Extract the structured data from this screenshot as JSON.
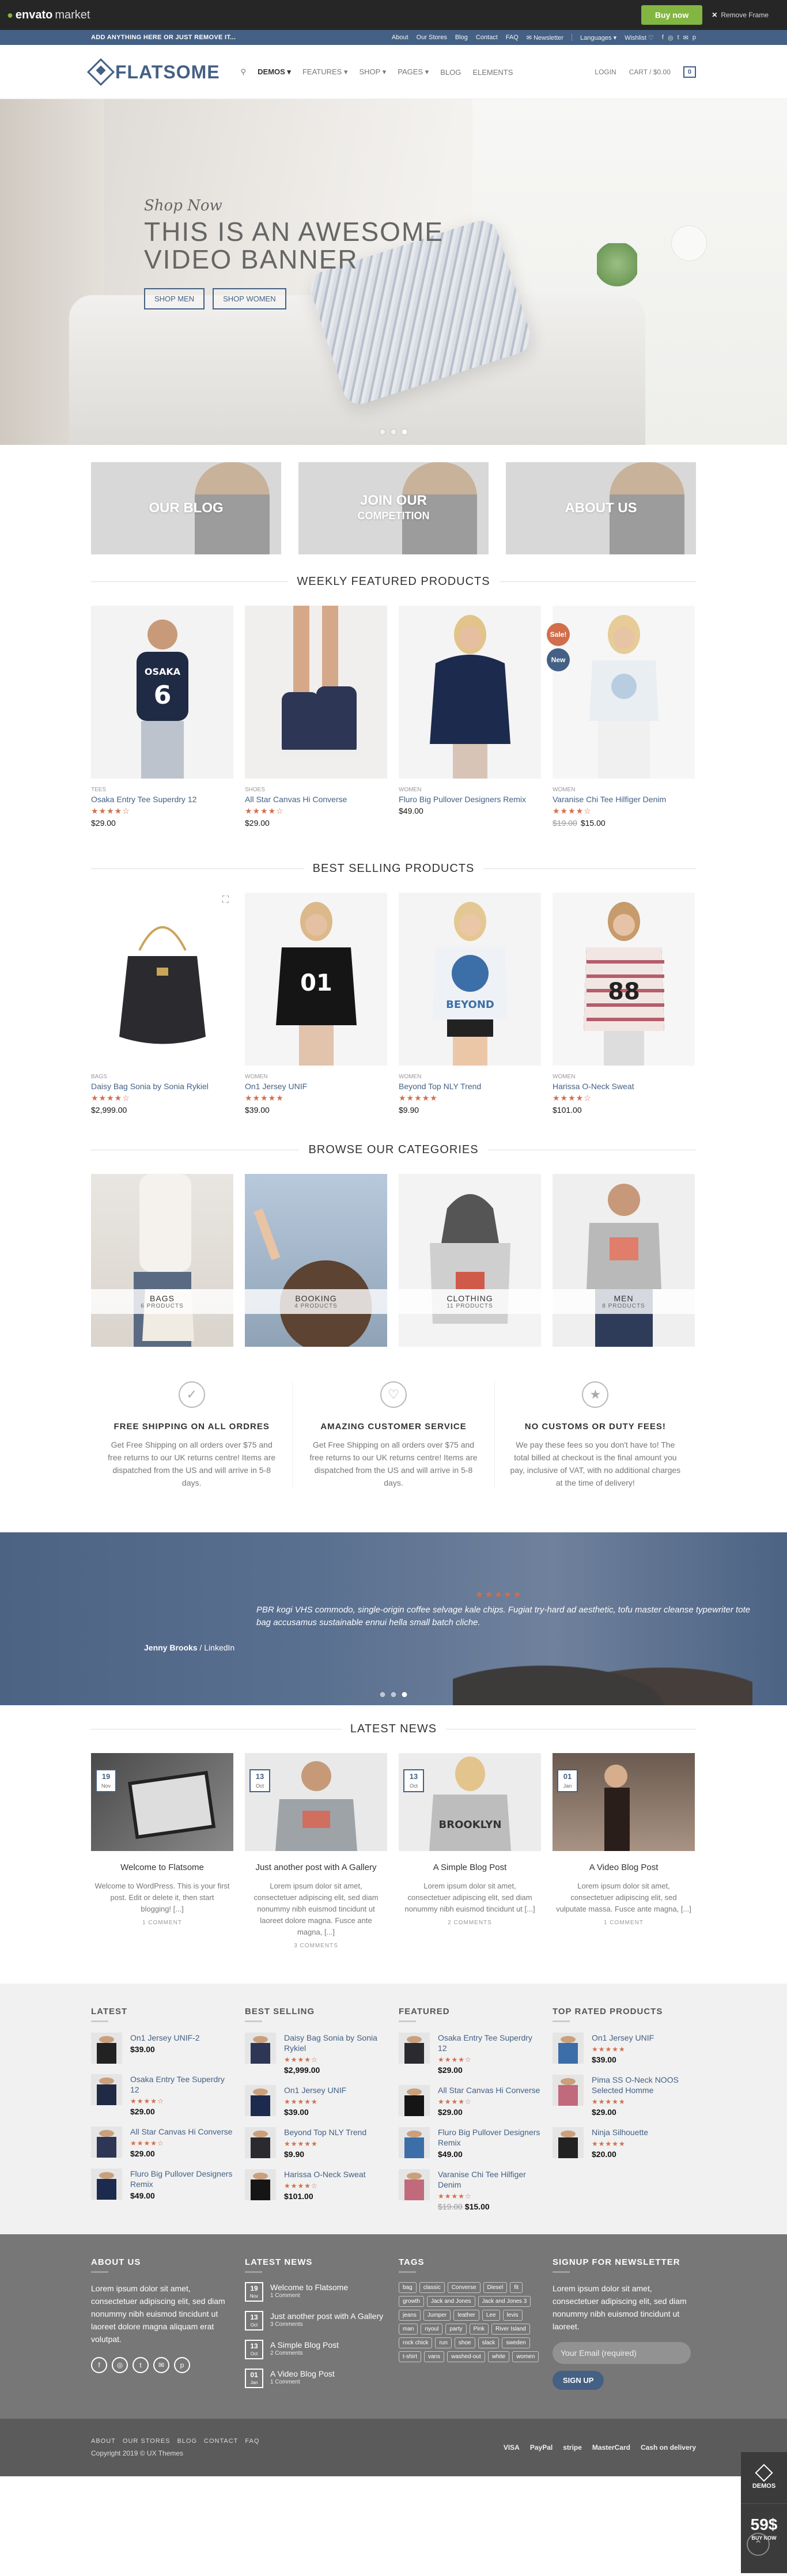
{
  "envato": {
    "brand_bold": "envato",
    "brand_light": "market",
    "buy_label": "Buy now",
    "remove_label": "Remove Frame"
  },
  "topbar": {
    "notice": "ADD ANYTHING HERE OR JUST REMOVE IT...",
    "links": [
      "About",
      "Our Stores",
      "Blog",
      "Contact",
      "FAQ",
      "Newsletter"
    ],
    "languages": "Languages",
    "wishlist": "Wishlist"
  },
  "header": {
    "logo": "FLATSOME",
    "nav": [
      "DEMOS",
      "FEATURES",
      "SHOP",
      "PAGES",
      "BLOG",
      "ELEMENTS"
    ],
    "login": "LOGIN",
    "cart": "CART / $0.00",
    "cart_count": "0"
  },
  "hero": {
    "script": "Shop Now",
    "title": "THIS IS AN AWESOME VIDEO BANNER",
    "btn_men": "SHOP MEN",
    "btn_women": "SHOP WOMEN"
  },
  "banners": [
    {
      "title": "OUR BLOG",
      "sub": ""
    },
    {
      "title": "JOIN OUR",
      "sub": "COMPETITION"
    },
    {
      "title": "ABOUT US",
      "sub": ""
    }
  ],
  "weekly": {
    "title": "WEEKLY FEATURED PRODUCTS",
    "items": [
      {
        "cat": "TEES",
        "name": "Osaka Entry Tee Superdry 12",
        "stars": "★★★★☆",
        "old": "",
        "price": "$29.00"
      },
      {
        "cat": "SHOES",
        "name": "All Star Canvas Hi Converse",
        "stars": "★★★★☆",
        "old": "",
        "price": "$29.00"
      },
      {
        "cat": "WOMEN",
        "name": "Fluro Big Pullover Designers Remix",
        "stars": "",
        "old": "",
        "price": "$49.00"
      },
      {
        "cat": "WOMEN",
        "name": "Varanise Chi Tee Hilfiger Denim",
        "stars": "★★★★☆",
        "old": "$19.00",
        "price": "$15.00",
        "sale": "Sale!",
        "new": "New"
      }
    ]
  },
  "bestselling": {
    "title": "BEST SELLING PRODUCTS",
    "items": [
      {
        "cat": "BAGS",
        "name": "Daisy Bag Sonia by Sonia Rykiel",
        "stars": "★★★★☆",
        "price": "$2,999.00"
      },
      {
        "cat": "WOMEN",
        "name": "On1 Jersey UNIF",
        "stars": "★★★★★",
        "price": "$39.00"
      },
      {
        "cat": "WOMEN",
        "name": "Beyond Top NLY Trend",
        "stars": "★★★★★",
        "price": "$9.90"
      },
      {
        "cat": "WOMEN",
        "name": "Harissa O-Neck Sweat",
        "stars": "★★★★☆",
        "price": "$101.00"
      }
    ]
  },
  "categories": {
    "title": "BROWSE OUR CATEGORIES",
    "items": [
      {
        "name": "BAGS",
        "count": "6 PRODUCTS"
      },
      {
        "name": "BOOKING",
        "count": "4 PRODUCTS"
      },
      {
        "name": "CLOTHING",
        "count": "11 PRODUCTS"
      },
      {
        "name": "MEN",
        "count": "8 PRODUCTS"
      }
    ]
  },
  "features": [
    {
      "icon": "check-circle-icon",
      "title": "FREE SHIPPING ON ALL ORDRES",
      "text": "Get Free Shipping on all orders over $75 and free returns to our UK returns centre! Items are dispatched from the US and will arrive in 5-8 days."
    },
    {
      "icon": "heart-icon",
      "title": "AMAZING CUSTOMER SERVICE",
      "text": "Get Free Shipping on all orders over $75 and free returns to our UK returns centre! Items are dispatched from the US and will arrive in 5-8 days."
    },
    {
      "icon": "star-icon",
      "title": "NO CUSTOMS OR DUTY FEES!",
      "text": "We pay these fees so you don't have to! The total billed at checkout is the final amount you pay, inclusive of VAT, with no additional charges at the time of delivery!"
    }
  ],
  "testimonial": {
    "stars": "★★★★★",
    "quote": "PBR kogi VHS commodo, single-origin coffee selvage kale chips. Fugiat try-hard ad aesthetic, tofu master cleanse typewriter tote bag accusamus sustainable ennui hella small batch cliche.",
    "author": "Jenny Brooks",
    "source": "LinkedIn"
  },
  "news": {
    "title": "LATEST NEWS",
    "posts": [
      {
        "day": "19",
        "month": "Nov",
        "title": "Welcome to Flatsome",
        "excerpt": "Welcome to WordPress. This is your first post. Edit or delete it, then start blogging! [...]",
        "comments": "1 COMMENT"
      },
      {
        "day": "13",
        "month": "Oct",
        "title": "Just another post with A Gallery",
        "excerpt": "Lorem ipsum dolor sit amet, consectetuer adipiscing elit, sed diam nonummy nibh euismod tincidunt ut laoreet dolore magna. Fusce ante magna, [...]",
        "comments": "3 COMMENTS"
      },
      {
        "day": "13",
        "month": "Oct",
        "title": "A Simple Blog Post",
        "excerpt": "Lorem ipsum dolor sit amet, consectetuer adipiscing elit, sed diam nonummy nibh euismod tincidunt ut [...]",
        "comments": "2 COMMENTS"
      },
      {
        "day": "01",
        "month": "Jan",
        "title": "A Video Blog Post",
        "excerpt": "Lorem ipsum dolor sit amet, consectetuer adipiscing elit, sed vulputate massa. Fusce ante magna, [...]",
        "comments": "1 COMMENT"
      }
    ]
  },
  "lists": [
    {
      "title": "LATEST",
      "items": [
        {
          "name": "On1 Jersey UNIF-2",
          "stars": "",
          "old": "",
          "price": "$39.00"
        },
        {
          "name": "Osaka Entry Tee Superdry 12",
          "stars": "★★★★☆",
          "old": "",
          "price": "$29.00"
        },
        {
          "name": "All Star Canvas Hi Converse",
          "stars": "★★★★☆",
          "old": "",
          "price": "$29.00"
        },
        {
          "name": "Fluro Big Pullover Designers Remix",
          "stars": "",
          "old": "",
          "price": "$49.00"
        }
      ]
    },
    {
      "title": "BEST SELLING",
      "items": [
        {
          "name": "Daisy Bag Sonia by Sonia Rykiel",
          "stars": "★★★★☆",
          "old": "",
          "price": "$2,999.00"
        },
        {
          "name": "On1 Jersey UNIF",
          "stars": "★★★★★",
          "old": "",
          "price": "$39.00"
        },
        {
          "name": "Beyond Top NLY Trend",
          "stars": "★★★★★",
          "old": "",
          "price": "$9.90"
        },
        {
          "name": "Harissa O-Neck Sweat",
          "stars": "★★★★☆",
          "old": "",
          "price": "$101.00"
        }
      ]
    },
    {
      "title": "FEATURED",
      "items": [
        {
          "name": "Osaka Entry Tee Superdry 12",
          "stars": "★★★★☆",
          "old": "",
          "price": "$29.00"
        },
        {
          "name": "All Star Canvas Hi Converse",
          "stars": "★★★★☆",
          "old": "",
          "price": "$29.00"
        },
        {
          "name": "Fluro Big Pullover Designers Remix",
          "stars": "",
          "old": "",
          "price": "$49.00"
        },
        {
          "name": "Varanise Chi Tee Hilfiger Denim",
          "stars": "★★★★☆",
          "old": "$19.00",
          "price": "$15.00"
        }
      ]
    },
    {
      "title": "TOP RATED PRODUCTS",
      "items": [
        {
          "name": "On1 Jersey UNIF",
          "stars": "★★★★★",
          "old": "",
          "price": "$39.00"
        },
        {
          "name": "Pima SS O-Neck NOOS Selected Homme",
          "stars": "★★★★★",
          "old": "",
          "price": "$29.00"
        },
        {
          "name": "Ninja Silhouette",
          "stars": "★★★★★",
          "old": "",
          "price": "$20.00"
        }
      ]
    }
  ],
  "footer": {
    "about_title": "ABOUT US",
    "about_text": "Lorem ipsum dolor sit amet, consectetuer adipiscing elit, sed diam nonummy nibh euismod tincidunt ut laoreet dolore magna aliquam erat volutpat.",
    "news_title": "LATEST NEWS",
    "news": [
      {
        "day": "19",
        "month": "Nov",
        "title": "Welcome to Flatsome",
        "comments": "1 Comment"
      },
      {
        "day": "13",
        "month": "Oct",
        "title": "Just another post with A Gallery",
        "comments": "3 Comments"
      },
      {
        "day": "13",
        "month": "Oct",
        "title": "A Simple Blog Post",
        "comments": "2 Comments"
      },
      {
        "day": "01",
        "month": "Jan",
        "title": "A Video Blog Post",
        "comments": "1 Comment"
      }
    ],
    "tags_title": "TAGS",
    "tags": [
      "bag",
      "classic",
      "Converse",
      "Diesel",
      "fit",
      "growth",
      "Jack and Jones",
      "Jack and Jones 3",
      "jeans",
      "Jumper",
      "leather",
      "Lee",
      "levis",
      "man",
      "nyoul",
      "party",
      "Pink",
      "River Island",
      "rock chick",
      "run",
      "shoe",
      "slack",
      "sweden",
      "t-shirt",
      "vans",
      "washed-out",
      "white",
      "women"
    ],
    "newsletter_title": "SIGNUP FOR NEWSLETTER",
    "newsletter_text": "Lorem ipsum dolor sit amet, consectetuer adipiscing elit, sed diam nonummy nibh euismod tincidunt ut laoreet.",
    "email_placeholder": "Your Email (required)",
    "signup": "SIGN UP"
  },
  "bottom": {
    "nav": [
      "ABOUT",
      "OUR STORES",
      "BLOG",
      "CONTACT",
      "FAQ"
    ],
    "copyright": "Copyright 2019 © UX Themes",
    "payments": [
      "VISA",
      "PayPal",
      "stripe",
      "MasterCard",
      "Cash on delivery"
    ]
  },
  "demos": {
    "label": "DEMOS",
    "price": "59$",
    "buy": "BUY NOW"
  },
  "colors": {
    "primary": "#446084",
    "accent": "#d26e4b",
    "envato_green": "#82b541"
  }
}
